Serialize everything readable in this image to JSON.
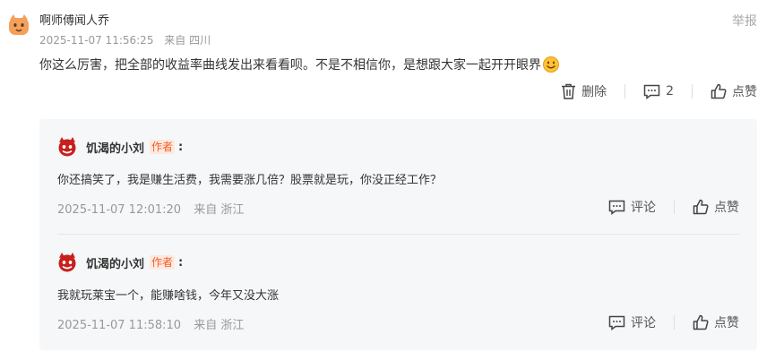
{
  "comment": {
    "username": "啊师傅闻人乔",
    "report_label": "举报",
    "timestamp": "2025-11-07 11:56:25",
    "location": "来自 四川",
    "text": "你这么厉害，把全部的收益率曲线发出来看看呗。不是不相信你，是想跟大家一起开开眼界",
    "delete_label": "删除",
    "reply_count": "2",
    "like_label": "点赞"
  },
  "replies": [
    {
      "username": "饥渴的小刘",
      "author_tag": "作者",
      "colon": ":",
      "text": "你还搞笑了，我是赚生活费，我需要涨几倍？股票就是玩，你没正经工作？",
      "timestamp": "2025-11-07 12:01:20",
      "location": "来自 浙江",
      "comment_label": "评论",
      "like_label": "点赞"
    },
    {
      "username": "饥渴的小刘",
      "author_tag": "作者",
      "colon": ":",
      "text": "我就玩莱宝一个，能赚啥钱，今年又没大涨",
      "timestamp": "2025-11-07 11:58:10",
      "location": "来自 浙江",
      "comment_label": "评论",
      "like_label": "点赞"
    }
  ],
  "colors": {
    "author_tag_text": "#f25d26",
    "author_tag_bg": "#fde9e0",
    "reply_bg": "#f6f7f8",
    "avatar_main": "#f5a05a",
    "avatar_reply": "#c8201c"
  },
  "icons": {
    "avatar_main": "cat-avatar-icon",
    "avatar_reply": "devil-avatar-icon",
    "emoji": "smile-emoji-icon",
    "delete": "trash-icon",
    "reply_count": "comment-bubble-icon",
    "like": "thumbs-up-icon"
  }
}
